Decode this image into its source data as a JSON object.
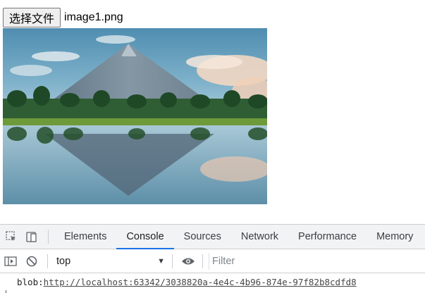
{
  "file_input": {
    "button_label": "选择文件",
    "file_name": "image1.png"
  },
  "image": {
    "description_icon": "mountain-lake-photo"
  },
  "devtools": {
    "icons": [
      "inspect-element-icon",
      "device-toolbar-icon"
    ],
    "tabs": [
      {
        "label": "Elements",
        "active": false
      },
      {
        "label": "Console",
        "active": true
      },
      {
        "label": "Sources",
        "active": false
      },
      {
        "label": "Network",
        "active": false
      },
      {
        "label": "Performance",
        "active": false
      },
      {
        "label": "Memory",
        "active": false
      }
    ],
    "toolbar": {
      "context": "top",
      "filter_placeholder": "Filter"
    },
    "console": {
      "prefix": "blob:",
      "link": "http://localhost:63342/3038820a-4e4c-4b96-874e-97f82b8cdfd8"
    },
    "colors": {
      "accent": "#1a73e8",
      "panel_bg": "#f1f3f4",
      "border": "#cbcdd1"
    }
  }
}
